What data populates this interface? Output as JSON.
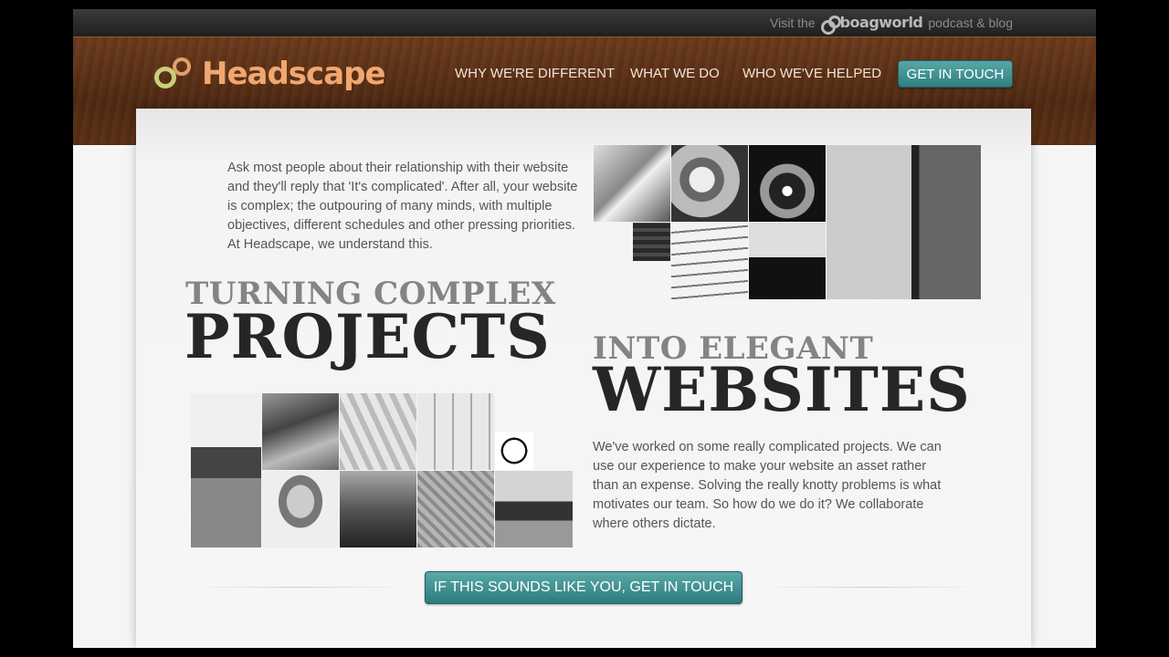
{
  "topbar": {
    "visit_prefix": "Visit the",
    "brand": "boagworld",
    "visit_suffix": "podcast & blog"
  },
  "header": {
    "logo_text": "Headscape",
    "nav": [
      {
        "label": "WHY WE'RE DIFFERENT"
      },
      {
        "label": "WHAT WE DO"
      },
      {
        "label": "WHO WE'VE HELPED"
      }
    ],
    "cta_label": "GET IN TOUCH"
  },
  "main": {
    "intro": "Ask most people about their relationship with their website and they'll reply that 'It's complicated'. After all, your website is complex; the outpouring of many minds, with multiple objectives, different schedules and other pressing priorities. At Headscape, we understand this.",
    "headline_1_small": "TURNING COMPLEX",
    "headline_1_big": "PROJECTS",
    "headline_2_small": "INTO ELEGANT",
    "headline_2_big": "WEBSITES",
    "outro": "We've worked on some really complicated projects. We can use our experience to make your website an asset rather than an expense. Solving the really knotty problems is what motivates our team. So how do we do it? We collaborate where others dictate.",
    "cta_label": "IF THIS SOUNDS LIKE YOU, GET IN TOUCH"
  },
  "colors": {
    "header_wood": "#5a2f15",
    "logo_orange": "#f0a770",
    "logo_green": "#c8cf78",
    "cta_teal": "#2f7f80",
    "headline_dark": "#262626",
    "headline_grey": "#848484"
  }
}
